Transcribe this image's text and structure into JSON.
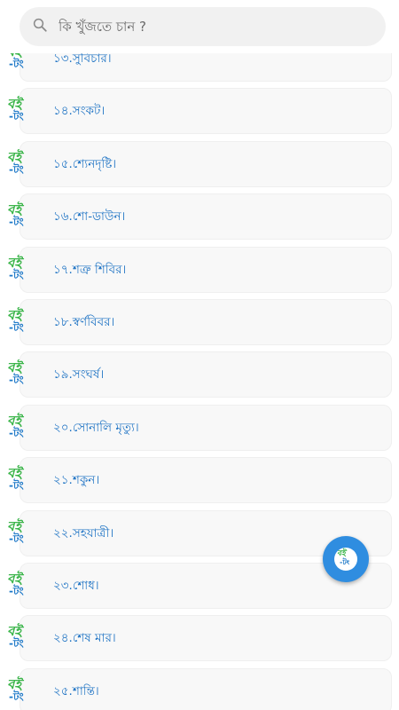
{
  "search": {
    "placeholder": "কি খুঁজতে চান ?",
    "icon": "search-icon"
  },
  "logo": {
    "line1": "বই",
    "line2": "-টং"
  },
  "items": [
    {
      "label": "১৩.সুবিচার।"
    },
    {
      "label": "১৪.সংকট।"
    },
    {
      "label": "১৫.শ্যেনদৃষ্টি।"
    },
    {
      "label": "১৬.শো-ডাউন।"
    },
    {
      "label": "১৭.শত্রু শিবির।"
    },
    {
      "label": "১৮.স্বর্ণবিবর।"
    },
    {
      "label": "১৯.সংঘর্ষ।"
    },
    {
      "label": "২০.সোনালি মৃত্যু।"
    },
    {
      "label": "২১.শকুন।"
    },
    {
      "label": "২২.সহযাত্রী।"
    },
    {
      "label": "২৩.শোধ।"
    },
    {
      "label": "২৪.শেষ মার।"
    },
    {
      "label": "২৫.শান্তি।"
    }
  ],
  "colors": {
    "accent": "#1e73c4",
    "logo_green": "#3bb54a",
    "fab": "#2f8de0"
  }
}
